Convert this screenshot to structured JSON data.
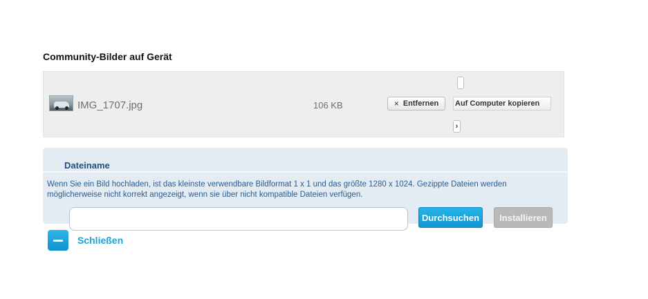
{
  "section": {
    "title": "Community-Bilder auf Gerät"
  },
  "file_list": {
    "items": [
      {
        "thumbnail_icon": "image-thumbnail-car",
        "name": "IMG_1707.jpg",
        "size": "106 KB",
        "remove_label": "Entfernen",
        "remove_icon": "×",
        "copy_label": "Auf Computer kopieren",
        "more_icon": "›"
      }
    ]
  },
  "upload": {
    "title": "Dateiname",
    "help_text": "Wenn Sie ein Bild hochladen, ist das kleinste verwendbare Bildformat 1 x 1 und das größte 1280 x 1024. Gezippte Dateien werden möglicherweise nicht korrekt angezeigt, wenn sie über nicht kompatible Dateien verfügen.",
    "file_value": "",
    "browse_label": "Durchsuchen",
    "install_label": "Installieren"
  },
  "footer": {
    "close_label": "Schließen"
  },
  "colors": {
    "accent": "#0f95d1",
    "panel_bg": "#e3ecf3",
    "panel_text": "#2b5c8f",
    "disabled": "#b9b9b9"
  }
}
